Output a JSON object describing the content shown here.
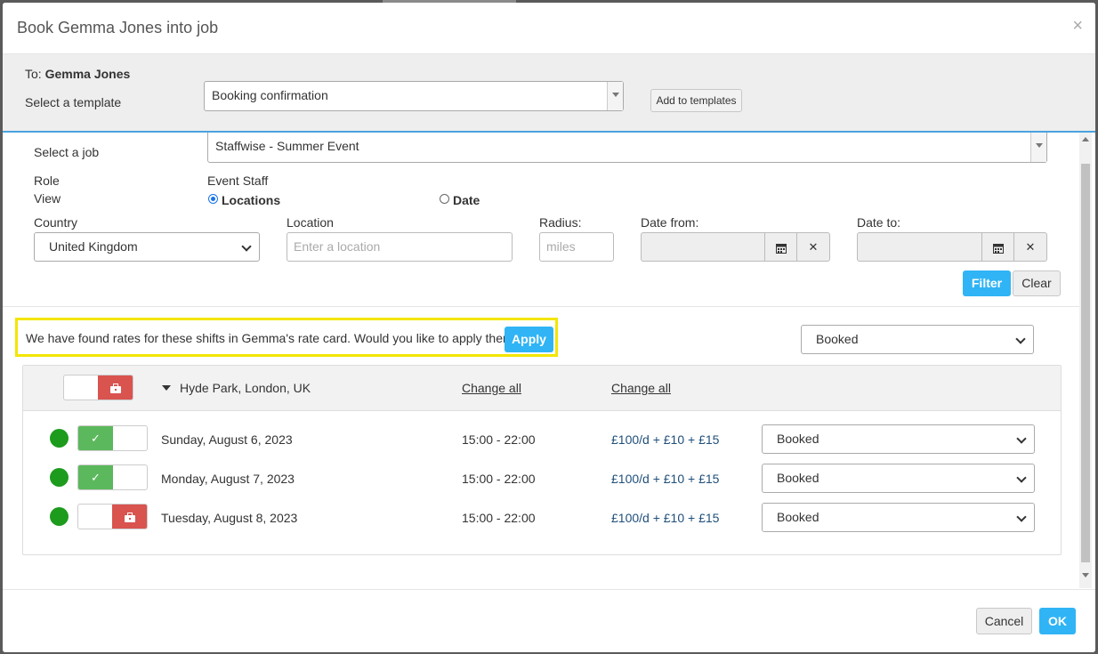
{
  "modal": {
    "title": "Book Gemma Jones into job",
    "close_icon": "×"
  },
  "template_bar": {
    "to_prefix": "To: ",
    "to_name": "Gemma Jones",
    "template_label": "Select a template",
    "template_value": "Booking confirmation",
    "add_button": "Add to templates"
  },
  "job": {
    "label": "Select a job",
    "value": "Staffwise - Summer Event"
  },
  "role": {
    "label": "Role",
    "value": "Event Staff"
  },
  "view": {
    "label": "View",
    "options": [
      {
        "label": "Locations",
        "checked": true
      },
      {
        "label": "Date",
        "checked": false
      }
    ]
  },
  "filters": {
    "country_label": "Country",
    "country_value": "United Kingdom",
    "location_label": "Location",
    "location_placeholder": "Enter a location",
    "radius_label": "Radius:",
    "radius_placeholder": "miles",
    "date_from_label": "Date from:",
    "date_to_label": "Date to:",
    "filter_button": "Filter",
    "clear_button": "Clear"
  },
  "rate_card": {
    "message": "We have found rates for these shifts in Gemma's rate card. Would you like to apply them?",
    "apply_button": "Apply",
    "status_all": "Booked"
  },
  "location_group": {
    "name": "Hyde Park, London, UK",
    "change_all_time": "Change all",
    "change_all_rate": "Change all",
    "toggle_state": "off",
    "shifts": [
      {
        "date": "Sunday, August 6, 2023",
        "time": "15:00 - 22:00",
        "rate": "£100/d + £10 + £15",
        "status": "Booked",
        "toggle_state": "on",
        "dot_color": "#1d9b1d"
      },
      {
        "date": "Monday, August 7, 2023",
        "time": "15:00 - 22:00",
        "rate": "£100/d + £10 + £15",
        "status": "Booked",
        "toggle_state": "on",
        "dot_color": "#1d9b1d"
      },
      {
        "date": "Tuesday, August 8, 2023",
        "time": "15:00 - 22:00",
        "rate": "£100/d + £10 + £15",
        "status": "Booked",
        "toggle_state": "off",
        "dot_color": "#1d9b1d"
      }
    ]
  },
  "footer": {
    "cancel_button": "Cancel",
    "ok_button": "OK"
  },
  "icons": {
    "check": "✓",
    "calendar": "calendar-icon",
    "clear": "✕",
    "briefcase": "briefcase-icon"
  },
  "colors": {
    "accent": "#30b4f5",
    "highlight": "#f3e600",
    "toggle_on": "#5cb85c",
    "toggle_off": "#d9534f",
    "status_dot": "#1d9b1d",
    "rate_link": "#1f4f7a"
  }
}
